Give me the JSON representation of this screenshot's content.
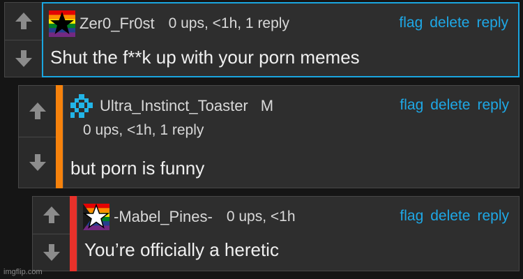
{
  "comments": [
    {
      "username": "Zer0_Fr0st",
      "meta": "0 ups, <1h, 1 reply",
      "text": "Shut the f**k up with your porn memes",
      "actions": {
        "flag": "flag",
        "delete": "delete",
        "reply": "reply"
      },
      "avatar_icon": "rainbow-flag-black-star-icon"
    },
    {
      "username": "Ultra_Instinct_Toaster",
      "badge": "M",
      "meta": "0 ups, <1h, 1 reply",
      "text": "but porn is funny",
      "actions": {
        "flag": "flag",
        "delete": "delete",
        "reply": "reply"
      },
      "avatar_icon": "pixel-blue-pattern-icon",
      "stripe_color": "#f6820c"
    },
    {
      "username": "-Mabel_Pines-",
      "meta": "0 ups, <1h",
      "text": "You’re officially a heretic",
      "actions": {
        "flag": "flag",
        "delete": "delete",
        "reply": "reply"
      },
      "avatar_icon": "rainbow-flag-white-star-icon",
      "stripe_color": "#e8312a"
    }
  ],
  "colors": {
    "highlight_border": "#1aa6e0",
    "link": "#1ea8e6",
    "background": "#151515",
    "panel": "#2e2e2e"
  },
  "watermark": "imgflip.com"
}
